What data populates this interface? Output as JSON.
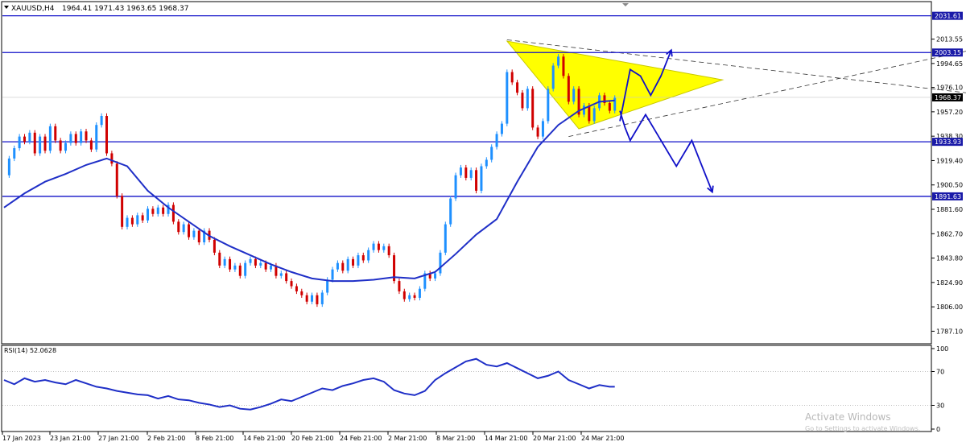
{
  "header": {
    "symbol": "XAUUSD,H4",
    "ohlc": "1964.41 1971.43 1963.65 1968.37"
  },
  "watermark": {
    "line1": "Activate Windows",
    "line2": "Go to Settings to activate Windows."
  },
  "colors": {
    "bull": "#1e90ff",
    "bear": "#d00000",
    "ma": "#1f2fc7",
    "level": "#1010c8",
    "triangle_fill": "#ffff00",
    "level_tag_bg": "#1a1aa8",
    "price_tag_bg": "#000000"
  },
  "chart_data": [
    {
      "type": "candlestick",
      "title": "XAUUSD,H4",
      "ylim": [
        1778,
        2042
      ],
      "price_ticks": [
        "2013.55",
        "1994.65",
        "1976.10",
        "1957.20",
        "1938.30",
        "1919.40",
        "1900.50",
        "1881.60",
        "1862.70",
        "1843.80",
        "1824.90",
        "1806.00",
        "1787.10"
      ],
      "date_ticks": [
        "17 Jan 2023",
        "23 Jan 21:00",
        "27 Jan 21:00",
        "2 Feb 21:00",
        "8 Feb 21:00",
        "14 Feb 21:00",
        "20 Feb 21:00",
        "24 Feb 21:00",
        "2 Mar 21:00",
        "8 Mar 21:00",
        "14 Mar 21:00",
        "20 Mar 21:00",
        "24 Mar 21:00"
      ],
      "horizontal_levels": [
        {
          "price": 2031.61,
          "label": "2031.61"
        },
        {
          "price": 2003.15,
          "label": "2003.15"
        },
        {
          "price": 1933.93,
          "label": "1933.93"
        },
        {
          "price": 1891.63,
          "label": "1891.63"
        }
      ],
      "current_price": {
        "price": 1968.37,
        "label": "1968.37"
      },
      "price_path": [
        [
          0,
          1908
        ],
        [
          1,
          1921
        ],
        [
          2,
          1929
        ],
        [
          3,
          1938
        ],
        [
          4,
          1934
        ],
        [
          5,
          1941
        ],
        [
          6,
          1925
        ],
        [
          7,
          1938
        ],
        [
          8,
          1927
        ],
        [
          9,
          1946
        ],
        [
          10,
          1935
        ],
        [
          11,
          1927
        ],
        [
          12,
          1933
        ],
        [
          13,
          1940
        ],
        [
          14,
          1933
        ],
        [
          15,
          1942
        ],
        [
          16,
          1935
        ],
        [
          17,
          1928
        ],
        [
          18,
          1947
        ],
        [
          19,
          1954
        ],
        [
          20,
          1925
        ],
        [
          21,
          1917
        ],
        [
          22,
          1892
        ],
        [
          23,
          1868
        ],
        [
          24,
          1875
        ],
        [
          25,
          1870
        ],
        [
          26,
          1877
        ],
        [
          27,
          1873
        ],
        [
          28,
          1882
        ],
        [
          29,
          1878
        ],
        [
          30,
          1883
        ],
        [
          31,
          1878
        ],
        [
          32,
          1885
        ],
        [
          33,
          1872
        ],
        [
          34,
          1864
        ],
        [
          35,
          1870
        ],
        [
          36,
          1860
        ],
        [
          37,
          1865
        ],
        [
          38,
          1856
        ],
        [
          39,
          1865
        ],
        [
          40,
          1858
        ],
        [
          41,
          1848
        ],
        [
          42,
          1838
        ],
        [
          43,
          1843
        ],
        [
          44,
          1835
        ],
        [
          45,
          1838
        ],
        [
          46,
          1830
        ],
        [
          47,
          1840
        ],
        [
          48,
          1843
        ],
        [
          49,
          1838
        ],
        [
          50,
          1840
        ],
        [
          51,
          1835
        ],
        [
          52,
          1838
        ],
        [
          53,
          1830
        ],
        [
          54,
          1832
        ],
        [
          55,
          1826
        ],
        [
          56,
          1822
        ],
        [
          57,
          1818
        ],
        [
          58,
          1815
        ],
        [
          59,
          1810
        ],
        [
          60,
          1815
        ],
        [
          61,
          1808
        ],
        [
          62,
          1817
        ],
        [
          63,
          1827
        ],
        [
          64,
          1835
        ],
        [
          65,
          1840
        ],
        [
          66,
          1834
        ],
        [
          67,
          1843
        ],
        [
          68,
          1838
        ],
        [
          69,
          1846
        ],
        [
          70,
          1842
        ],
        [
          71,
          1850
        ],
        [
          72,
          1855
        ],
        [
          73,
          1850
        ],
        [
          74,
          1853
        ],
        [
          75,
          1846
        ],
        [
          76,
          1826
        ],
        [
          77,
          1818
        ],
        [
          78,
          1812
        ],
        [
          79,
          1815
        ],
        [
          80,
          1813
        ],
        [
          81,
          1820
        ],
        [
          82,
          1832
        ],
        [
          83,
          1828
        ],
        [
          84,
          1832
        ],
        [
          85,
          1848
        ],
        [
          86,
          1870
        ],
        [
          87,
          1890
        ],
        [
          88,
          1908
        ],
        [
          89,
          1914
        ],
        [
          90,
          1906
        ],
        [
          91,
          1912
        ],
        [
          92,
          1896
        ],
        [
          93,
          1915
        ],
        [
          94,
          1920
        ],
        [
          95,
          1930
        ],
        [
          96,
          1940
        ],
        [
          97,
          1948
        ],
        [
          98,
          1988
        ],
        [
          99,
          1980
        ],
        [
          100,
          1972
        ],
        [
          101,
          1960
        ],
        [
          102,
          1975
        ],
        [
          103,
          1945
        ],
        [
          104,
          1938
        ],
        [
          105,
          1950
        ],
        [
          106,
          1975
        ],
        [
          107,
          1993
        ],
        [
          108,
          2000
        ],
        [
          109,
          1985
        ],
        [
          110,
          1965
        ],
        [
          111,
          1975
        ],
        [
          112,
          1955
        ],
        [
          113,
          1962
        ],
        [
          114,
          1950
        ],
        [
          115,
          1960
        ],
        [
          116,
          1970
        ],
        [
          117,
          1964
        ],
        [
          118,
          1958
        ],
        [
          119,
          1968
        ]
      ],
      "moving_average": [
        [
          0,
          1883
        ],
        [
          4,
          1894
        ],
        [
          8,
          1903
        ],
        [
          12,
          1909
        ],
        [
          16,
          1916
        ],
        [
          20,
          1921
        ],
        [
          24,
          1915
        ],
        [
          28,
          1896
        ],
        [
          32,
          1883
        ],
        [
          36,
          1872
        ],
        [
          40,
          1861
        ],
        [
          44,
          1853
        ],
        [
          48,
          1846
        ],
        [
          52,
          1839
        ],
        [
          56,
          1833
        ],
        [
          60,
          1828
        ],
        [
          64,
          1826
        ],
        [
          68,
          1826
        ],
        [
          72,
          1827
        ],
        [
          76,
          1829
        ],
        [
          80,
          1828
        ],
        [
          84,
          1833
        ],
        [
          88,
          1847
        ],
        [
          92,
          1862
        ],
        [
          96,
          1874
        ],
        [
          100,
          1903
        ],
        [
          104,
          1930
        ],
        [
          108,
          1947
        ],
        [
          112,
          1958
        ],
        [
          116,
          1965
        ],
        [
          119,
          1966
        ]
      ],
      "projection_up": [
        [
          120,
          1950
        ],
        [
          122,
          1990
        ],
        [
          124,
          1985
        ],
        [
          126,
          1970
        ],
        [
          128,
          1985
        ],
        [
          130,
          2005
        ]
      ],
      "projection_down": [
        [
          120,
          1958
        ],
        [
          121,
          1945
        ],
        [
          122,
          1935
        ],
        [
          125,
          1955
        ],
        [
          128,
          1935
        ],
        [
          131,
          1915
        ],
        [
          134,
          1935
        ],
        [
          137,
          1905
        ],
        [
          138,
          1895
        ]
      ],
      "triangle": [
        [
          98,
          2012
        ],
        [
          112,
          1944
        ],
        [
          140,
          1982
        ]
      ],
      "trendline_upper": [
        [
          98,
          2013
        ],
        [
          220,
          1957
        ]
      ],
      "trendline_lower": [
        [
          110,
          1938
        ],
        [
          220,
          2032
        ]
      ],
      "x_count": 181
    },
    {
      "type": "line",
      "title": "RSI(14) 52.0628",
      "ylim": [
        0,
        100
      ],
      "y_ticks": [
        "100",
        "70",
        "30",
        "0"
      ],
      "levels": [
        70,
        30
      ],
      "values": [
        [
          0,
          60
        ],
        [
          2,
          55
        ],
        [
          4,
          62
        ],
        [
          6,
          58
        ],
        [
          8,
          60
        ],
        [
          10,
          57
        ],
        [
          12,
          55
        ],
        [
          14,
          60
        ],
        [
          16,
          56
        ],
        [
          18,
          52
        ],
        [
          20,
          50
        ],
        [
          22,
          47
        ],
        [
          24,
          45
        ],
        [
          26,
          43
        ],
        [
          28,
          42
        ],
        [
          30,
          38
        ],
        [
          32,
          41
        ],
        [
          34,
          37
        ],
        [
          36,
          36
        ],
        [
          38,
          33
        ],
        [
          40,
          31
        ],
        [
          42,
          28
        ],
        [
          44,
          30
        ],
        [
          46,
          26
        ],
        [
          48,
          25
        ],
        [
          50,
          28
        ],
        [
          52,
          32
        ],
        [
          54,
          37
        ],
        [
          56,
          35
        ],
        [
          58,
          40
        ],
        [
          60,
          45
        ],
        [
          62,
          50
        ],
        [
          64,
          48
        ],
        [
          66,
          53
        ],
        [
          68,
          56
        ],
        [
          70,
          60
        ],
        [
          72,
          62
        ],
        [
          74,
          58
        ],
        [
          76,
          48
        ],
        [
          78,
          44
        ],
        [
          80,
          42
        ],
        [
          82,
          47
        ],
        [
          84,
          60
        ],
        [
          86,
          68
        ],
        [
          88,
          75
        ],
        [
          90,
          82
        ],
        [
          92,
          85
        ],
        [
          94,
          78
        ],
        [
          96,
          76
        ],
        [
          98,
          80
        ],
        [
          100,
          74
        ],
        [
          102,
          68
        ],
        [
          104,
          62
        ],
        [
          106,
          65
        ],
        [
          108,
          70
        ],
        [
          110,
          60
        ],
        [
          112,
          55
        ],
        [
          114,
          50
        ],
        [
          116,
          54
        ],
        [
          118,
          52
        ],
        [
          119,
          52
        ]
      ],
      "x_count": 181
    }
  ]
}
